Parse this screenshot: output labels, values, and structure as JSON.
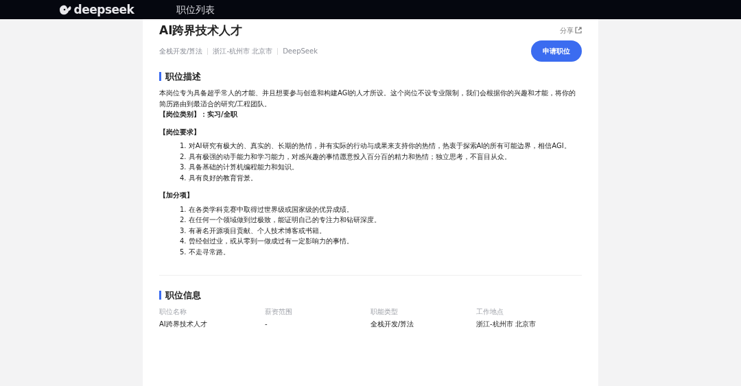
{
  "nav": {
    "logo_text": "deepseek",
    "links": [
      "职位列表"
    ]
  },
  "job": {
    "title": "AI跨界技术人才",
    "share": "分享",
    "meta": [
      "全栈开发/算法",
      "浙江-杭州市 北京市",
      "DeepSeek"
    ],
    "apply_button": "申请职位"
  },
  "description": {
    "heading": "职位描述",
    "blocks": [
      {
        "kind": "paragraph",
        "text": "本岗位专为具备超乎常人的才能、并且想要参与创造和构建AGI的人才所设。这个岗位不设专业限制，我们会根据你的兴趣和才能，将你的简历路由到最适合的研究/工程团队。"
      },
      {
        "kind": "strong",
        "text": "【岗位类别】：实习/全职"
      },
      {
        "kind": "subheading",
        "text": "【岗位要求】"
      },
      {
        "kind": "list",
        "items": [
          "1. 对AI研究有极大的、真实的、长期的热情，并有实际的行动与成果来支持你的热情，热衷于探索AI的所有可能边界，相信AGI。",
          "2. 具有极强的动手能力和学习能力，对感兴趣的事情愿意投入百分百的精力和热情；独立思考，不盲目从众。",
          "3. 具备基础的计算机编程能力和知识。",
          "4. 具有良好的教育背景。"
        ]
      },
      {
        "kind": "subheading",
        "text": "【加分项】"
      },
      {
        "kind": "list",
        "items": [
          "1. 在各类学科竞赛中取得过世界级或国家级的优异成绩。",
          "2. 在任何一个领域做到过极致，能证明自己的专注力和钻研深度。",
          "3. 有著名开源项目贡献、个人技术博客或书籍。",
          "4. 曾经创过业，或从零到一做成过有一定影响力的事情。",
          "5. 不走寻常路。"
        ]
      }
    ]
  },
  "info": {
    "heading": "职位信息",
    "fields": [
      {
        "label": "职位名称",
        "value": "AI跨界技术人才"
      },
      {
        "label": "薪资范围",
        "value": "-"
      },
      {
        "label": "职能类型",
        "value": "全栈开发/算法"
      },
      {
        "label": "工作地点",
        "value": "浙江-杭州市 北京市"
      }
    ]
  }
}
